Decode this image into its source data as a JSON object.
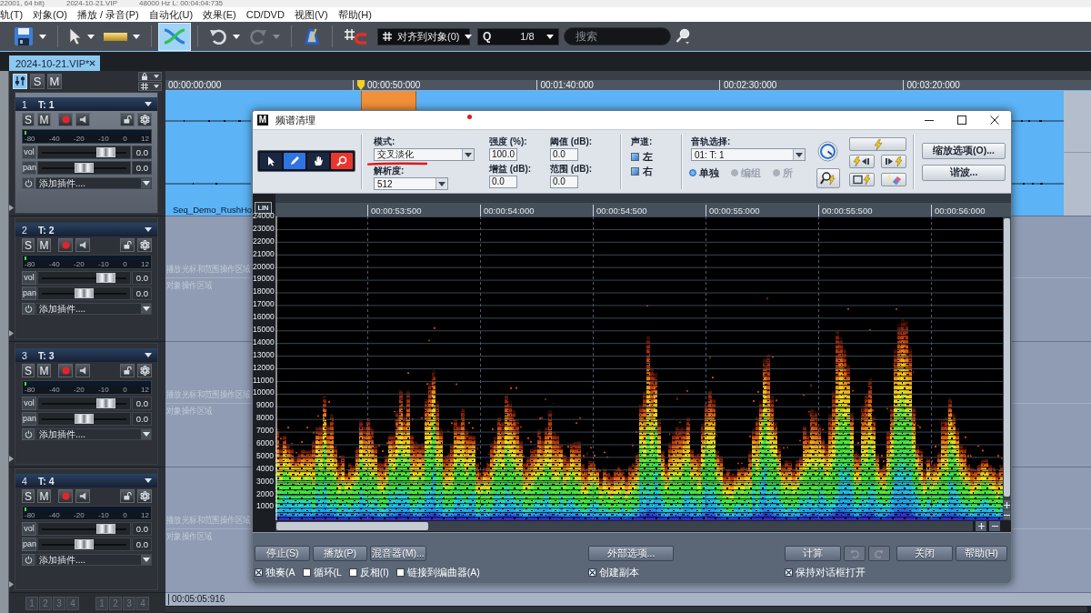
{
  "title_strip": [
    "22001, 64 bit)",
    "2024-10-21.VIP",
    "48000 Hz L: 00:04:04:735"
  ],
  "menu": [
    "轨(T)",
    "对象(O)",
    "播放 / 录音(P)",
    "自动化(U)",
    "效果(E)",
    "CD/DVD",
    "视图(V)",
    "帮助(H)"
  ],
  "toolbar": {
    "groups": [
      {
        "tools": [
          {
            "kind": "save",
            "selected": false,
            "disabled": false,
            "dropdown": true
          }
        ]
      },
      {
        "tools": [
          {
            "kind": "pointer",
            "selected": false,
            "disabled": false,
            "dropdown": true
          },
          {
            "kind": "range",
            "selected": false,
            "disabled": false,
            "dropdown": true
          }
        ]
      },
      {
        "tools": [
          {
            "kind": "crossfade",
            "selected": true,
            "disabled": false,
            "dropdown": false
          }
        ]
      },
      {
        "tools": [
          {
            "kind": "undo",
            "selected": false,
            "disabled": false,
            "dropdown": true
          },
          {
            "kind": "redo",
            "selected": false,
            "disabled": true,
            "dropdown": true
          }
        ]
      },
      {
        "tools": [
          {
            "kind": "metronome",
            "selected": false,
            "disabled": false,
            "dropdown": false
          }
        ]
      },
      {
        "tools": [
          {
            "kind": "snap",
            "selected": false,
            "disabled": false,
            "dropdown": false
          }
        ]
      }
    ],
    "snap_mode": "对齐到对象(0)",
    "quantize_prefix": "Q",
    "quantize": "1/8",
    "search": {
      "placeholder": "搜索"
    }
  },
  "project_tab": {
    "label": "2024-10-21.VIP*",
    "selected": true
  },
  "track_header": {
    "mixer_selected": true,
    "solo": "S",
    "mute": "M"
  },
  "tracks": [
    {
      "number": "1",
      "name": "T: 1",
      "selected": true,
      "solo": "S",
      "mute": "M",
      "meter": {
        "scale": [
          "-80",
          "-40",
          "-20",
          "-10",
          "0",
          "12"
        ],
        "level": 0.015
      },
      "vol": {
        "label": "vol",
        "value": "0.0",
        "level": 0.8
      },
      "pan": {
        "label": "pan",
        "value": "0.0",
        "level": 0.5
      },
      "plugin": "添加插件....",
      "lane": {
        "clip": "Seq_Demo_RushHo"
      }
    },
    {
      "number": "2",
      "name": "T: 2",
      "selected": false,
      "solo": "S",
      "mute": "M",
      "meter": {
        "scale": [
          "-80",
          "-40",
          "-20",
          "-10",
          "0",
          "12"
        ],
        "level": 0.015
      },
      "vol": {
        "label": "vol",
        "value": "0.0",
        "level": 0.8
      },
      "pan": {
        "label": "pan",
        "value": "0.0",
        "level": 0.5
      },
      "plugin": "添加插件....",
      "lane": {
        "hints": [
          "播放光标和范围操作区域",
          "对象操作区域"
        ]
      }
    },
    {
      "number": "3",
      "name": "T: 3",
      "selected": false,
      "solo": "S",
      "mute": "M",
      "meter": {
        "scale": [
          "-80",
          "-40",
          "-20",
          "-10",
          "0",
          "12"
        ],
        "level": 0.015
      },
      "vol": {
        "label": "vol",
        "value": "0.0",
        "level": 0.8
      },
      "pan": {
        "label": "pan",
        "value": "0.0",
        "level": 0.5
      },
      "plugin": "添加插件....",
      "lane": {
        "hints": [
          "播放光标和范围操作区域",
          "对象操作区域"
        ]
      }
    },
    {
      "number": "4",
      "name": "T: 4",
      "selected": false,
      "solo": "S",
      "mute": "M",
      "meter": {
        "scale": [
          "-80",
          "-40",
          "-20",
          "-10",
          "0",
          "12"
        ],
        "level": 0.015
      },
      "vol": {
        "label": "vol",
        "value": "0.0",
        "level": 0.8
      },
      "pan": {
        "label": "pan",
        "value": "0.0",
        "level": 0.5
      },
      "plugin": "添加插件....",
      "lane": {
        "hints": [
          "播放光标和范围操作区域",
          "对象操作区域"
        ]
      }
    }
  ],
  "ruler": [
    "00:00:00:000",
    "00:00:50:000",
    "00:01:40:000",
    "00:02:30:000",
    "00:03:20:000"
  ],
  "position": "00:05:05:916",
  "banks": [
    {
      "buttons": [
        "1",
        "2",
        "3",
        "4"
      ]
    },
    {
      "buttons": [
        "1",
        "2",
        "3",
        "4"
      ]
    }
  ],
  "dialog": {
    "logo": "M",
    "title": "频谱清理",
    "tools": [
      {
        "kind": "pointer",
        "color": "#1b2740"
      },
      {
        "kind": "pencil",
        "color": "#2f74e0"
      },
      {
        "kind": "hand",
        "color": "#1b2740"
      },
      {
        "kind": "zoom",
        "color": "#e8382e"
      }
    ],
    "mode": {
      "label": "模式:",
      "value": "交叉淡化"
    },
    "resolution": {
      "label": "解析度:",
      "value": "512"
    },
    "strength": {
      "label": "强度 (%):",
      "value": "100.0"
    },
    "gain": {
      "label": "增益 (dB):",
      "value": "0.0"
    },
    "threshold": {
      "label": "阈值 (dB):",
      "value": "0.0"
    },
    "range": {
      "label": "范围 (dB):",
      "value": "0.0"
    },
    "channels": {
      "label": "声道:",
      "items": [
        {
          "label": "左",
          "checked": true
        },
        {
          "label": "右",
          "checked": true
        }
      ]
    },
    "track_select": {
      "label": "音轨选择:",
      "value": "01: T: 1",
      "modes": [
        {
          "label": "单独",
          "selected": true,
          "disabled": false
        },
        {
          "label": "编组",
          "selected": false,
          "disabled": true
        },
        {
          "label": "所",
          "selected": false,
          "disabled": true
        }
      ]
    },
    "side_buttons": [
      "缩放选项(O)...",
      "谐波..."
    ],
    "spectrum": {
      "scale": "LIN",
      "times": [
        "00:00:53:500",
        "00:00:54:000",
        "00:00:54:500",
        "00:00:55:000",
        "00:00:55:500",
        "00:00:56:000"
      ],
      "frequencies": [
        "24000",
        "23000",
        "22000",
        "21000",
        "20000",
        "19000",
        "18000",
        "17000",
        "16000",
        "15000",
        "14000",
        "13000",
        "12000",
        "11000",
        "10000",
        "9000",
        "8000",
        "7000",
        "6000",
        "5000",
        "4000",
        "3000",
        "2000",
        "1000"
      ]
    },
    "transport": [
      "停止(S)",
      "播放(P)",
      "混音器(M)..."
    ],
    "options": [
      {
        "label": "独奏(A",
        "checked": true
      },
      {
        "label": "循环(L",
        "checked": false
      },
      {
        "label": "反相(I)",
        "checked": false
      },
      {
        "label": "链接到编曲器(A)",
        "checked": false
      }
    ],
    "external": "外部选项...",
    "copy_option": {
      "label": "创建副本",
      "checked": true
    },
    "compute": "计算",
    "history": [
      {
        "kind": "undo",
        "disabled": true
      },
      {
        "kind": "redo",
        "disabled": true
      }
    ],
    "close": "关闭",
    "help": "帮助(H)",
    "keep_open": {
      "label": "保持对话框打开",
      "checked": true
    }
  }
}
